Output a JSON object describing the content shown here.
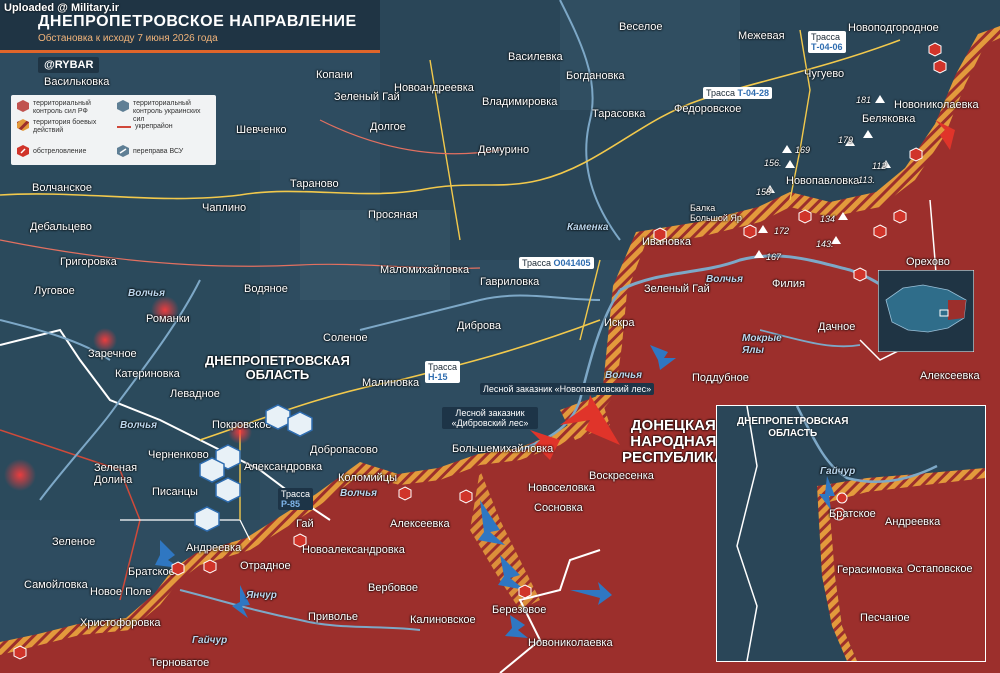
{
  "watermark": "Uploaded @ Military.ir",
  "header": {
    "title": "ДНЕПРОПЕТРОВСКОЕ НАПРАВЛЕНИЕ",
    "subtitle": "Обстановка к исходу 7 июня 2026 года",
    "channel": "@RYBAR"
  },
  "legend": {
    "ru_control": "территориальный контроль сил РФ",
    "ua_control": "территориальный контроль украинских сил",
    "combat": "территория боевых действий",
    "fortification": "укрепрайон",
    "shelling": "обстреловление",
    "crossing": "переправа ВСУ"
  },
  "colors": {
    "ru": "#9c2f2c",
    "ua": "#2c4a5e",
    "combat": "#e39a3c",
    "front": "#f08a3a"
  },
  "regions": {
    "dnepr": [
      "ДНЕПРОПЕТРОВСКАЯ",
      "ОБЛАСТЬ"
    ],
    "dnr": [
      "ДОНЕЦКАЯ",
      "НАРОДНАЯ",
      "РЕСПУБЛИКА"
    ]
  },
  "roads": {
    "t0406": {
      "name": "Трасса",
      "code": "Т-04-06"
    },
    "t0428": {
      "name": "Трасса",
      "code": "Т-04-28"
    },
    "o041405": {
      "name": "Трасса",
      "code": "О041405"
    },
    "h15": {
      "name": "Трасса",
      "code": "Н-15"
    },
    "p85": {
      "name": "Трасса",
      "code": "Р-85"
    }
  },
  "reserves": {
    "novopavlovsky": "Лесной заказник «Новопавловский лес»",
    "dibrovsky": "Лесной заказник «Дибровский лес»",
    "balka": [
      "Балка",
      "Большой Яр"
    ]
  },
  "rivers": {
    "volchya1": "Волчья",
    "volchya2": "Волчья",
    "volchya3": "Волчья",
    "volchya4": "Волчья",
    "volchya5": "Волчья",
    "kamenka": "Каменка",
    "yanchur": "Янчур",
    "gaichur": "Гайчур",
    "mokrye": [
      "Мокрые",
      "Ялы"
    ],
    "volchya_inset": "Гайчур"
  },
  "towns": {
    "vasilkovka": "Васильковка",
    "volchanskoe": "Волчанское",
    "debaltsevo": "Дебальцево",
    "grigorovka": "Григоровка",
    "lugovoe": "Луговое",
    "romanki": "Романки",
    "zarechnoe": "Заречное",
    "katerinovka": "Катериновка",
    "levadnoe": "Левадное",
    "chernenkovo": "Черненково",
    "zelenaya": [
      "Зеленая",
      "Долина"
    ],
    "zelenoe": "Зеленое",
    "samoilovka": "Самойловка",
    "novoe_pole": "Новое Поле",
    "bratskoe": "Братское",
    "andreevka": "Андреевка",
    "khristoforovka": "Христофоровка",
    "ternovatoe": "Терноватое",
    "pisantsy": "Писанцы",
    "pokrovskoe": "Покровское",
    "aleksandrovka": "Александровка",
    "otradnoe": "Отрадное",
    "gai": "Гай",
    "novoaleksandrovka": "Новоалександровка",
    "dobropasovo": "Добропасово",
    "kolomiytsy": "Коломийцы",
    "alekseevka": "Алексеевка",
    "verbovoe": "Вербовое",
    "privolye": "Приволье",
    "kalinovskoe": "Калиновское",
    "berezovoe": "Березовое",
    "novonikolaevka": "Новониколаевка",
    "sosnovka": "Сосновка",
    "novoselovka": "Новоселовка",
    "bolshemikhailovka": "Большемихайловка",
    "voskresenka": "Воскресенка",
    "poddubnoe": "Поддубное",
    "iskra": "Искра",
    "zeleny_gai": "Зеленый Гай",
    "filiya": "Филия",
    "dachnoe": "Дачное",
    "orekhovo": "Орехово",
    "alekseevka2": "Алексеевка",
    "gavrilovka": "Гавриловка",
    "dibrova": "Диброва",
    "solenoe": "Соленое",
    "malinovka": "Малиновка",
    "vodyanoe": "Водяное",
    "chaplino": "Чаплино",
    "taranovo": "Тараново",
    "prosyanaya": "Просяная",
    "malomikhailovka": "Маломихайловка",
    "demurino": "Демурино",
    "ivanovka": "Ивановка",
    "novopavlovka": "Новопавловка",
    "belyakovka": "Беляковка",
    "novonikolaevka2": "Новониколаевка",
    "chuguevo": "Чугуево",
    "fedorovskoe": "Федоровское",
    "tarasovka": "Тарасовка",
    "vladimirovka": "Владимировка",
    "bogdanovka": "Богдановка",
    "vasilevka": "Василевка",
    "veseloe": "Веселое",
    "mezhevaya": "Межевая",
    "novopodgorodnoe": "Новоподгородное",
    "kopani": "Копани",
    "zeleny_gai2": "Зеленый Гай",
    "novoandreevka": "Новоандреевка",
    "dolgoe": "Долгое",
    "shevchenko": "Шевченко"
  },
  "heights": {
    "h181": "181",
    "h179": "179",
    "h112": "112",
    "h113": "113.",
    "h169": "169",
    "h156": "156.",
    "h158": "158",
    "h172": "172",
    "h134": "134",
    "h143": "143.",
    "h167": "167"
  },
  "inset": {
    "region": [
      "ДНЕПРОПЕТРОВСКАЯ",
      "ОБЛАСТЬ"
    ],
    "bratskoe": "Братское",
    "andreevka": "Андреевка",
    "gerasimovka": "Герасимовка",
    "ostapovskoe": "Остаповское",
    "pesчanoe": "Песчаное"
  }
}
